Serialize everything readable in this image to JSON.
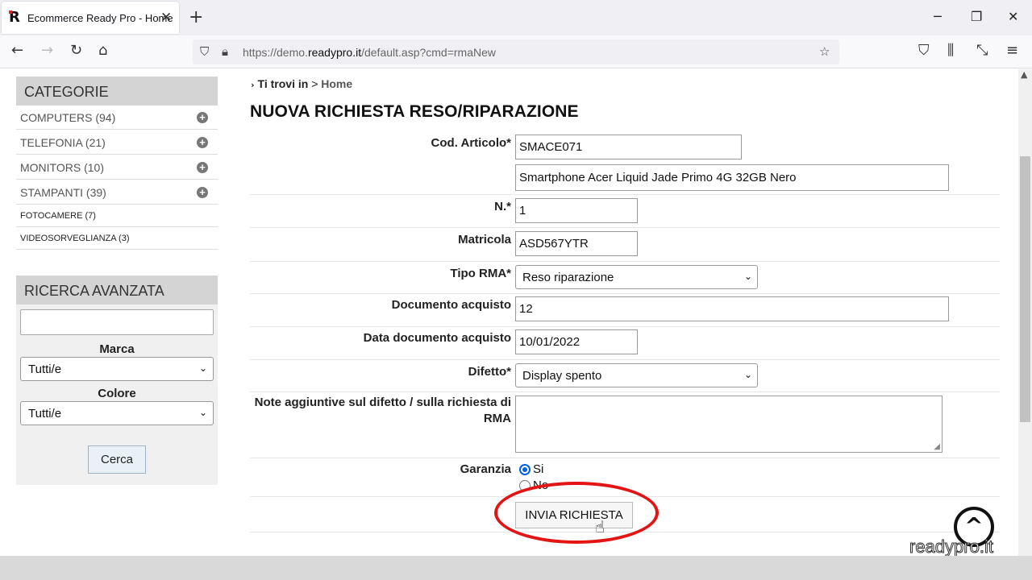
{
  "browser": {
    "tab_title": "Ecommerce Ready Pro - Home",
    "favicon_letter": "R",
    "url_prefix": "https://demo.",
    "url_domain": "readypro.it",
    "url_path": "/default.asp?cmd=rmaNew",
    "accent_color": "#e52421"
  },
  "sidebar": {
    "categories_title": "CATEGORIE",
    "categories": [
      {
        "label": "COMPUTERS (94)",
        "expandable": true
      },
      {
        "label": "TELEFONIA (21)",
        "expandable": true
      },
      {
        "label": "MONITORS (10)",
        "expandable": true
      },
      {
        "label": "STAMPANTI (39)",
        "expandable": true
      },
      {
        "label": "FOTOCAMERE (7)",
        "expandable": false
      },
      {
        "label": "VIDEOSORVEGLIANZA (3)",
        "expandable": false
      }
    ],
    "search_title": "RICERCA AVANZATA",
    "search_value": "",
    "brand_label": "Marca",
    "brand_value": "Tutti/e",
    "color_label": "Colore",
    "color_value": "Tutti/e",
    "search_button": "Cerca"
  },
  "main": {
    "breadcrumb_prefix": "Ti trovi in",
    "breadcrumb_sep": ">",
    "breadcrumb_home": "Home",
    "title": "NUOVA RICHIESTA RESO/RIPARAZIONE",
    "form": {
      "code_label": "Cod. Articolo*",
      "code_value": "SMACE071",
      "description_value": "Smartphone Acer Liquid Jade Primo 4G 32GB Nero",
      "qty_label": "N.*",
      "qty_value": "1",
      "serial_label": "Matricola",
      "serial_value": "ASD567YTR",
      "rma_type_label": "Tipo RMA*",
      "rma_type_value": "Reso riparazione",
      "doc_label": "Documento acquisto",
      "doc_value": "12",
      "doc_date_label": "Data documento acquisto",
      "doc_date_value": "10/01/2022",
      "defect_label": "Difetto*",
      "defect_value": "Display spento",
      "notes_label": "Note aggiuntive sul difetto / sulla richiesta di RMA",
      "notes_value": "",
      "warranty_label": "Garanzia",
      "warranty_yes": "Si",
      "warranty_no": "No",
      "warranty_selected": "Si",
      "submit_label": "INVIA RICHIESTA"
    }
  },
  "watermark": "readypro.it",
  "annotation_color": "#e21414"
}
